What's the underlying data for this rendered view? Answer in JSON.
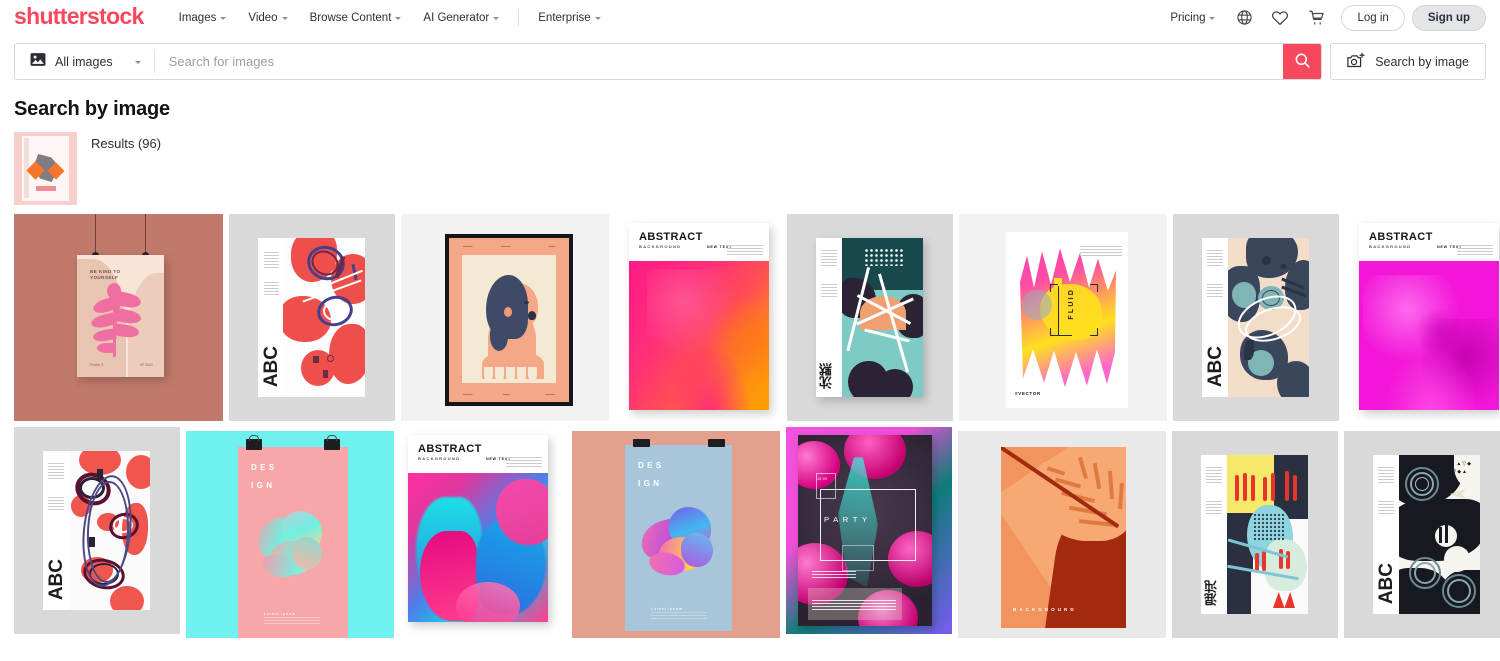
{
  "header": {
    "logo": "shutterstock",
    "nav": [
      {
        "label": "Images",
        "has_caret": true
      },
      {
        "label": "Video",
        "has_caret": true
      },
      {
        "label": "Browse Content",
        "has_caret": true
      },
      {
        "label": "AI Generator",
        "has_caret": true
      },
      {
        "label": "Enterprise",
        "has_caret": true
      }
    ],
    "right": {
      "pricing_label": "Pricing",
      "globe_icon": "globe-icon",
      "favorites_icon": "heart-icon",
      "cart_icon": "shopping-cart-icon",
      "login_label": "Log in",
      "signup_label": "Sign up"
    }
  },
  "search": {
    "category_label": "All images",
    "category_icon": "image-icon",
    "placeholder": "Search for images",
    "value": "",
    "submit_icon": "search-icon",
    "search_by_image_label": "Search by image",
    "search_by_image_icon": "camera-plus-icon",
    "accent_color": "#f8485e"
  },
  "page": {
    "title": "Search by image",
    "results_label": "Results (96)",
    "query_thumbnail_alt": "pink poster with dark ink splatter and orange diamonds"
  },
  "grid": {
    "rows": [
      {
        "tiles": [
          {
            "name": "result-tile-1",
            "alt": "Terracotta wall mockup with hanging pink botanical leaf poster",
            "bg": "#c0796a"
          },
          {
            "name": "result-tile-2",
            "alt": "ABC abstract poster with red and navy brush swirls",
            "bg": "#d9d9d9"
          },
          {
            "name": "result-tile-3",
            "alt": "Framed peach portrait poster of a person in profile",
            "bg": "#f2f2f2"
          },
          {
            "name": "result-tile-4",
            "alt": "Abstract Background cover with pink to orange gradient",
            "bg": "#ffffff"
          },
          {
            "name": "result-tile-5",
            "alt": "Teal and navy poster with Japanese characters and white geometric lines",
            "bg": "#d9d9d9"
          },
          {
            "name": "result-tile-6",
            "alt": "Fluid vector poster with pink and yellow watercolor",
            "bg": "#f2f2f2"
          },
          {
            "name": "result-tile-7",
            "alt": "ABC poster with navy teal and beige organic shapes",
            "bg": "#d9d9d9"
          },
          {
            "name": "result-tile-8",
            "alt": "Abstract Background cover with magenta gradient",
            "bg": "#ffffff"
          }
        ]
      },
      {
        "tiles": [
          {
            "name": "result-tile-9",
            "alt": "ABC poster with red blobs and dark scribble swirls",
            "bg": "#d9d9d9"
          },
          {
            "name": "result-tile-10",
            "alt": "Cyan background with pink DESIGN poster on binder clips",
            "bg": "#6ff2ef"
          },
          {
            "name": "result-tile-11",
            "alt": "Abstract Background cover with pink and cyan liquid gradient",
            "bg": "#ffffff"
          },
          {
            "name": "result-tile-12",
            "alt": "Salmon background with blue DESIGN poster on clips",
            "bg": "#e3a08c"
          },
          {
            "name": "result-tile-13",
            "alt": "Party poster with neon pink spheres and teal glow",
            "bg": "#ef57d8"
          },
          {
            "name": "result-tile-14",
            "alt": "Orange monstera leaf poster labelled Background",
            "bg": "#e9e9e9"
          },
          {
            "name": "result-tile-15",
            "alt": "Yellow red and teal poster with Japanese characters",
            "bg": "#d9d9d9"
          },
          {
            "name": "result-tile-16",
            "alt": "Black and white ABC poster with spiral motifs",
            "bg": "#d9d9d9"
          }
        ]
      }
    ]
  },
  "poster_text": {
    "abc": "ABC",
    "abstract": "ABSTRACT",
    "background_sub": "BACKGROUND",
    "design_1": "DES",
    "design_2": "IGN",
    "party": "PARTY",
    "fluid": "FLUID",
    "vector": "#VECTOR",
    "background_caption": "BACKGROUND",
    "be_kind_1": "BE KIND TO",
    "be_kind_2": "YOURSELF",
    "jp_1": "沈黙",
    "jp_2": "混沌",
    "lorem": "Lorem ipsum",
    "poster_meta_left": "Poster 1",
    "poster_meta_right": "Nº 2022",
    "new_text": "NEW TEXT"
  }
}
